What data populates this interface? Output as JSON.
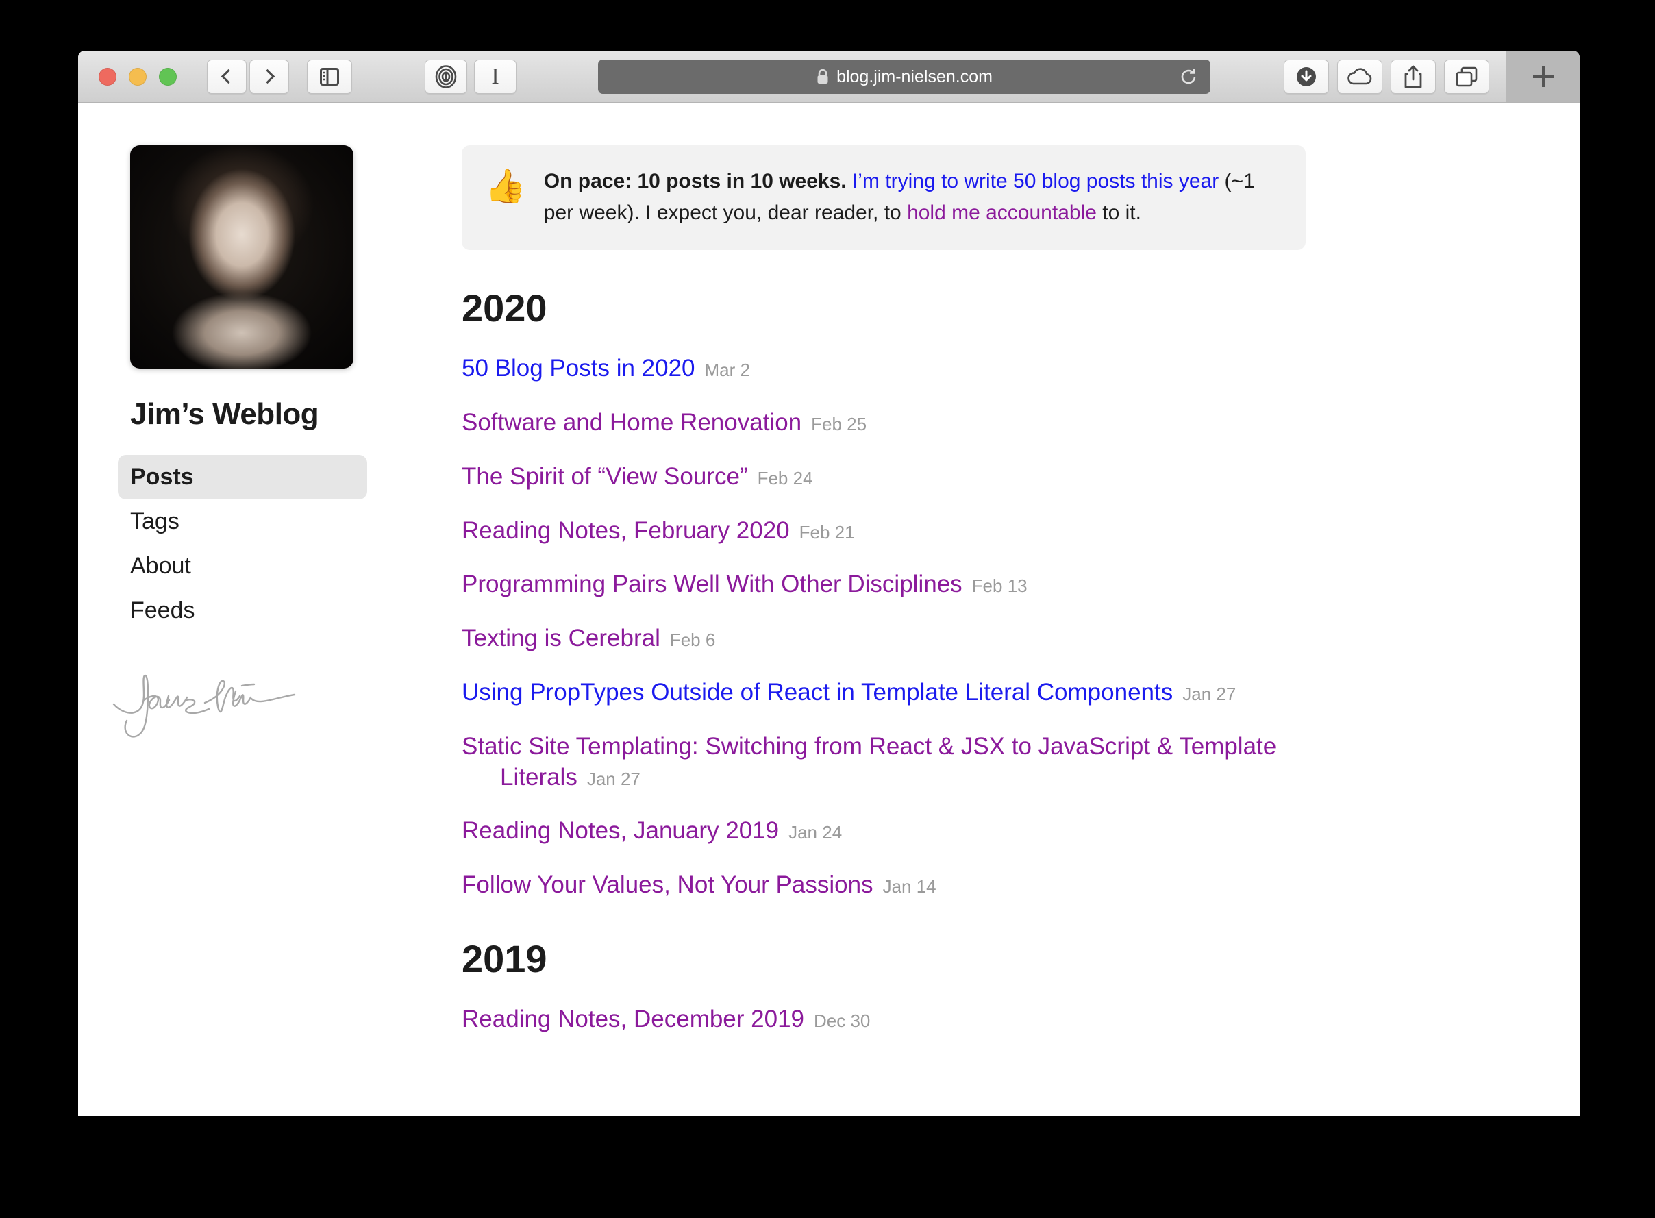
{
  "browser": {
    "url": "blog.jim-nielsen.com",
    "lock_icon": "lock-icon",
    "buttons": {
      "back": "back-button",
      "forward": "forward-button",
      "sidebar": "sidebar-toggle-button",
      "onepassword": "1password-extension-button",
      "instapaper_label": "I",
      "reload": "reload-button",
      "downloads": "downloads-button",
      "icloud_tabs": "icloud-tabs-button",
      "share": "share-button",
      "tab_overview": "tab-overview-button",
      "new_tab": "new-tab-button"
    }
  },
  "sidebar": {
    "avatar_alt": "Portrait photo of Jim Nielsen",
    "title": "Jim’s Weblog",
    "items": [
      {
        "label": "Posts",
        "active": true
      },
      {
        "label": "Tags",
        "active": false
      },
      {
        "label": "About",
        "active": false
      },
      {
        "label": "Feeds",
        "active": false
      }
    ],
    "signature_alt": "Handwritten signature"
  },
  "callout": {
    "emoji": "👍",
    "bold_text": "On pace: 10 posts in 10 weeks.",
    "link_text": "I’m trying to write 50 blog posts this year",
    "middle_text": " (~1 per week). I expect you, dear reader, to ",
    "visited_link_text": "hold me accountable",
    "end_text": " to it."
  },
  "content": {
    "sections": [
      {
        "year": "2020",
        "posts": [
          {
            "title": "50 Blog Posts in 2020",
            "date": "Mar 2",
            "visited": false
          },
          {
            "title": "Software and Home Renovation",
            "date": "Feb 25",
            "visited": true
          },
          {
            "title": "The Spirit of “View Source”",
            "date": "Feb 24",
            "visited": true
          },
          {
            "title": "Reading Notes, February 2020",
            "date": "Feb 21",
            "visited": true
          },
          {
            "title": "Programming Pairs Well With Other Disciplines",
            "date": "Feb 13",
            "visited": true
          },
          {
            "title": "Texting is Cerebral",
            "date": "Feb 6",
            "visited": true
          },
          {
            "title": "Using PropTypes Outside of React in Template Literal Components",
            "date": "Jan 27",
            "visited": false
          },
          {
            "title": "Static Site Templating: Switching from React & JSX to JavaScript & Template Literals",
            "date": "Jan 27",
            "visited": true
          },
          {
            "title": "Reading Notes, January 2019",
            "date": "Jan 24",
            "visited": true
          },
          {
            "title": "Follow Your Values, Not Your Passions",
            "date": "Jan 14",
            "visited": true
          }
        ]
      },
      {
        "year": "2019",
        "posts": [
          {
            "title": "Reading Notes, December 2019",
            "date": "Dec 30",
            "visited": true
          }
        ]
      }
    ]
  },
  "colors": {
    "link_unvisited": "#1a1aee",
    "link_visited": "#8b1a9b",
    "date": "#9a9a9a",
    "callout_bg": "#f2f2f2",
    "active_nav_bg": "#e6e6e6"
  }
}
